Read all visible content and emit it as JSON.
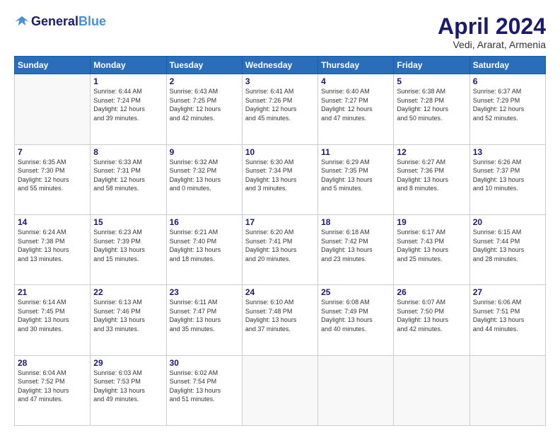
{
  "header": {
    "logo_line1": "General",
    "logo_line2": "Blue",
    "month_title": "April 2024",
    "location": "Vedi, Ararat, Armenia"
  },
  "weekdays": [
    "Sunday",
    "Monday",
    "Tuesday",
    "Wednesday",
    "Thursday",
    "Friday",
    "Saturday"
  ],
  "weeks": [
    [
      {
        "day": "",
        "info": ""
      },
      {
        "day": "1",
        "info": "Sunrise: 6:44 AM\nSunset: 7:24 PM\nDaylight: 12 hours\nand 39 minutes."
      },
      {
        "day": "2",
        "info": "Sunrise: 6:43 AM\nSunset: 7:25 PM\nDaylight: 12 hours\nand 42 minutes."
      },
      {
        "day": "3",
        "info": "Sunrise: 6:41 AM\nSunset: 7:26 PM\nDaylight: 12 hours\nand 45 minutes."
      },
      {
        "day": "4",
        "info": "Sunrise: 6:40 AM\nSunset: 7:27 PM\nDaylight: 12 hours\nand 47 minutes."
      },
      {
        "day": "5",
        "info": "Sunrise: 6:38 AM\nSunset: 7:28 PM\nDaylight: 12 hours\nand 50 minutes."
      },
      {
        "day": "6",
        "info": "Sunrise: 6:37 AM\nSunset: 7:29 PM\nDaylight: 12 hours\nand 52 minutes."
      }
    ],
    [
      {
        "day": "7",
        "info": "Sunrise: 6:35 AM\nSunset: 7:30 PM\nDaylight: 12 hours\nand 55 minutes."
      },
      {
        "day": "8",
        "info": "Sunrise: 6:33 AM\nSunset: 7:31 PM\nDaylight: 12 hours\nand 58 minutes."
      },
      {
        "day": "9",
        "info": "Sunrise: 6:32 AM\nSunset: 7:32 PM\nDaylight: 13 hours\nand 0 minutes."
      },
      {
        "day": "10",
        "info": "Sunrise: 6:30 AM\nSunset: 7:34 PM\nDaylight: 13 hours\nand 3 minutes."
      },
      {
        "day": "11",
        "info": "Sunrise: 6:29 AM\nSunset: 7:35 PM\nDaylight: 13 hours\nand 5 minutes."
      },
      {
        "day": "12",
        "info": "Sunrise: 6:27 AM\nSunset: 7:36 PM\nDaylight: 13 hours\nand 8 minutes."
      },
      {
        "day": "13",
        "info": "Sunrise: 6:26 AM\nSunset: 7:37 PM\nDaylight: 13 hours\nand 10 minutes."
      }
    ],
    [
      {
        "day": "14",
        "info": "Sunrise: 6:24 AM\nSunset: 7:38 PM\nDaylight: 13 hours\nand 13 minutes."
      },
      {
        "day": "15",
        "info": "Sunrise: 6:23 AM\nSunset: 7:39 PM\nDaylight: 13 hours\nand 15 minutes."
      },
      {
        "day": "16",
        "info": "Sunrise: 6:21 AM\nSunset: 7:40 PM\nDaylight: 13 hours\nand 18 minutes."
      },
      {
        "day": "17",
        "info": "Sunrise: 6:20 AM\nSunset: 7:41 PM\nDaylight: 13 hours\nand 20 minutes."
      },
      {
        "day": "18",
        "info": "Sunrise: 6:18 AM\nSunset: 7:42 PM\nDaylight: 13 hours\nand 23 minutes."
      },
      {
        "day": "19",
        "info": "Sunrise: 6:17 AM\nSunset: 7:43 PM\nDaylight: 13 hours\nand 25 minutes."
      },
      {
        "day": "20",
        "info": "Sunrise: 6:15 AM\nSunset: 7:44 PM\nDaylight: 13 hours\nand 28 minutes."
      }
    ],
    [
      {
        "day": "21",
        "info": "Sunrise: 6:14 AM\nSunset: 7:45 PM\nDaylight: 13 hours\nand 30 minutes."
      },
      {
        "day": "22",
        "info": "Sunrise: 6:13 AM\nSunset: 7:46 PM\nDaylight: 13 hours\nand 33 minutes."
      },
      {
        "day": "23",
        "info": "Sunrise: 6:11 AM\nSunset: 7:47 PM\nDaylight: 13 hours\nand 35 minutes."
      },
      {
        "day": "24",
        "info": "Sunrise: 6:10 AM\nSunset: 7:48 PM\nDaylight: 13 hours\nand 37 minutes."
      },
      {
        "day": "25",
        "info": "Sunrise: 6:08 AM\nSunset: 7:49 PM\nDaylight: 13 hours\nand 40 minutes."
      },
      {
        "day": "26",
        "info": "Sunrise: 6:07 AM\nSunset: 7:50 PM\nDaylight: 13 hours\nand 42 minutes."
      },
      {
        "day": "27",
        "info": "Sunrise: 6:06 AM\nSunset: 7:51 PM\nDaylight: 13 hours\nand 44 minutes."
      }
    ],
    [
      {
        "day": "28",
        "info": "Sunrise: 6:04 AM\nSunset: 7:52 PM\nDaylight: 13 hours\nand 47 minutes."
      },
      {
        "day": "29",
        "info": "Sunrise: 6:03 AM\nSunset: 7:53 PM\nDaylight: 13 hours\nand 49 minutes."
      },
      {
        "day": "30",
        "info": "Sunrise: 6:02 AM\nSunset: 7:54 PM\nDaylight: 13 hours\nand 51 minutes."
      },
      {
        "day": "",
        "info": ""
      },
      {
        "day": "",
        "info": ""
      },
      {
        "day": "",
        "info": ""
      },
      {
        "day": "",
        "info": ""
      }
    ]
  ]
}
